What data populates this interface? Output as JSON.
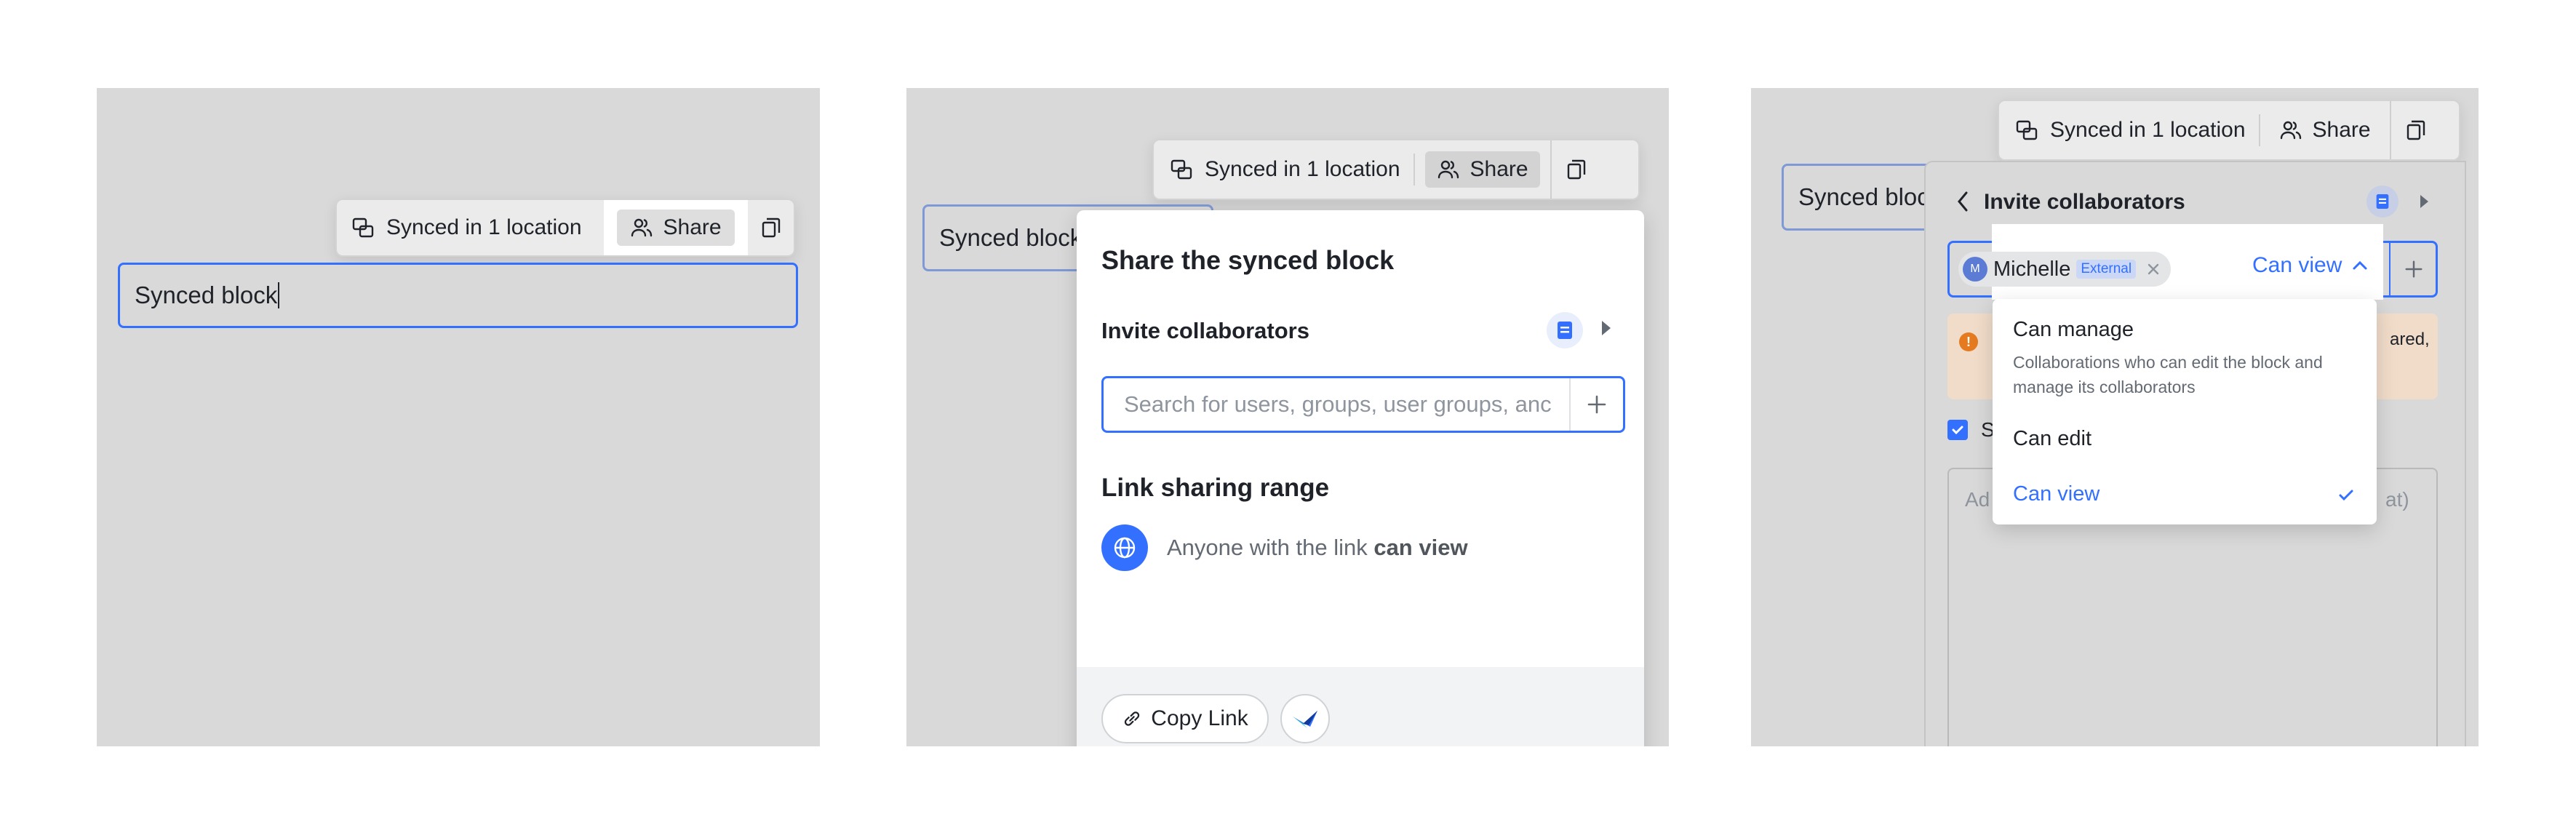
{
  "toolbar": {
    "synced_label": "Synced in 1 location",
    "share_label": "Share"
  },
  "block": {
    "text": "Synced block"
  },
  "share_popup": {
    "title": "Share the synced block",
    "invite_label": "Invite collaborators",
    "search_placeholder": "Search for users, groups, user groups, anc",
    "link_range_title": "Link sharing range",
    "link_text_prefix": "Anyone with the link ",
    "link_text_perm": "can view",
    "copy_link_label": "Copy Link"
  },
  "invite_panel": {
    "title": "Invite collaborators",
    "chip_name": "Michelle",
    "chip_initial": "M",
    "chip_badge": "External",
    "permission": "Can view",
    "warning_fragment_1": "ared,",
    "checkbox_fragment": "S",
    "textarea_fragment_1": "Ad",
    "textarea_fragment_2": "at)"
  },
  "permission_menu": {
    "options": [
      {
        "label": "Can manage",
        "desc": "Collaborations who can edit the block and manage its collaborators"
      },
      {
        "label": "Can edit",
        "desc": ""
      },
      {
        "label": "Can view",
        "desc": ""
      }
    ],
    "selected": "Can view"
  },
  "colors": {
    "accent": "#3370ff",
    "panel_bg": "#d9d9d9",
    "warning_bg": "#fbe4d0",
    "warning_icon": "#e57a1e"
  },
  "icons": [
    "sync-icon",
    "share-people-icon",
    "copy-icon",
    "doc-icon",
    "caret-right-icon",
    "plus-icon",
    "globe-icon",
    "link-icon",
    "app-logo-icon",
    "back-icon",
    "close-icon",
    "chevron-up-icon",
    "check-icon",
    "warning-icon",
    "checkbox-icon"
  ]
}
